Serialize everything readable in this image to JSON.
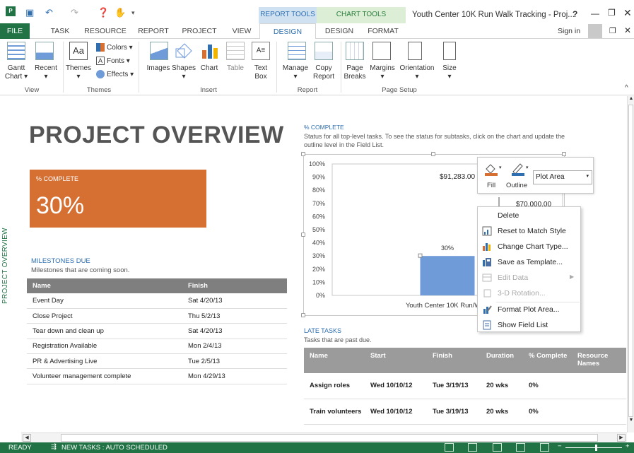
{
  "window": {
    "title": "Youth Center 10K Run Walk Tracking - Proj...",
    "help": "?",
    "signin": "Sign in",
    "context_tabs": {
      "report_tools": "REPORT TOOLS",
      "chart_tools": "CHART TOOLS"
    }
  },
  "tabs": [
    "FILE",
    "TASK",
    "RESOURCE",
    "REPORT",
    "PROJECT",
    "VIEW",
    "DESIGN",
    "DESIGN",
    "FORMAT"
  ],
  "ribbon": {
    "view": {
      "gantt": "Gantt",
      "gantt2": "Chart ▾",
      "recent": "Recent",
      "recent2": "▾",
      "label": "View"
    },
    "themes": {
      "themes": "Themes",
      "themes2": "▾",
      "colors": "Colors ▾",
      "fonts": "Fonts ▾",
      "effects": "Effects ▾",
      "label": "Themes"
    },
    "insert": {
      "images": "Images",
      "shapes": "Shapes",
      "shapes2": "▾",
      "chart": "Chart",
      "table": "Table",
      "textbox": "Text",
      "textbox2": "Box",
      "label": "Insert"
    },
    "report": {
      "manage": "Manage",
      "manage2": "▾",
      "copy": "Copy",
      "copy2": "Report",
      "label": "Report"
    },
    "pagesetup": {
      "pagebreaks": "Page",
      "pagebreaks2": "Breaks",
      "margins": "Margins",
      "margins2": "▾",
      "orientation": "Orientation",
      "orientation2": "▾",
      "size": "Size",
      "size2": "▾",
      "label": "Page Setup"
    }
  },
  "overview": {
    "side_label": "PROJECT OVERVIEW",
    "title": "PROJECT OVERVIEW",
    "pct_label": "% COMPLETE",
    "pct_value": "30%",
    "milestones_title": "MILESTONES DUE",
    "milestones_sub": "Milestones that are coming soon.",
    "milestones_headers": [
      "Name",
      "Finish"
    ],
    "milestones": [
      [
        "Event Day",
        "Sat 4/20/13"
      ],
      [
        "Close Project",
        "Thu 5/2/13"
      ],
      [
        "Tear down and clean up",
        "Sat 4/20/13"
      ],
      [
        "Registration Available",
        "Mon 2/4/13"
      ],
      [
        "PR & Advertising Live",
        "Tue 2/5/13"
      ],
      [
        "Volunteer management complete",
        "Mon 4/29/13"
      ]
    ]
  },
  "chart_section": {
    "title": "% COMPLETE",
    "desc1": "Status for all top-level tasks. To see the status for subtasks, click on the chart and update the",
    "desc2": "outline level in the Field List."
  },
  "chart_data": {
    "type": "bar",
    "categories": [
      "Youth Center 10K Run/Walk"
    ],
    "values": [
      30
    ],
    "data_labels": [
      "30%"
    ],
    "yticks": [
      "0%",
      "10%",
      "20%",
      "30%",
      "40%",
      "50%",
      "60%",
      "70%",
      "80%",
      "90%",
      "100%"
    ],
    "ylim": [
      0,
      100
    ],
    "annotations": [
      "$91,283.00",
      "$70,000.00"
    ],
    "bar_color": "#6f9bd8"
  },
  "late_tasks": {
    "title": "LATE TASKS",
    "sub": "Tasks that are past due.",
    "headers": [
      "Name",
      "Start",
      "Finish",
      "Duration",
      "% Complete",
      "Resource Names"
    ],
    "rows": [
      [
        "Assign roles",
        "Wed 10/10/12",
        "Tue 3/19/13",
        "20 wks",
        "0%",
        ""
      ],
      [
        "Train volunteers",
        "Wed 10/10/12",
        "Tue 3/19/13",
        "20 wks",
        "0%",
        ""
      ]
    ]
  },
  "floatbar": {
    "fill": "Fill",
    "outline": "Outline",
    "selection": "Plot Area"
  },
  "context_menu": [
    {
      "label": "Delete",
      "enabled": true,
      "icon": "none"
    },
    {
      "label": "Reset to Match Style",
      "enabled": true,
      "icon": "reset-style-icon"
    },
    {
      "label": "Change Chart Type...",
      "enabled": true,
      "icon": "chart-type-icon"
    },
    {
      "label": "Save as Template...",
      "enabled": true,
      "icon": "save-template-icon"
    },
    {
      "label": "Edit Data",
      "enabled": false,
      "icon": "edit-data-icon"
    },
    {
      "label": "3-D Rotation...",
      "enabled": false,
      "icon": "rotation-icon"
    },
    {
      "label": "Format Plot Area...",
      "enabled": true,
      "icon": "format-plot-icon"
    },
    {
      "label": "Show Field List",
      "enabled": true,
      "icon": "field-list-icon"
    }
  ],
  "statusbar": {
    "ready": "READY",
    "newtasks": "NEW TASKS : AUTO SCHEDULED"
  },
  "colors": {
    "accent": "#217346",
    "orange": "#d56f32",
    "blue": "#2f6fb0"
  }
}
